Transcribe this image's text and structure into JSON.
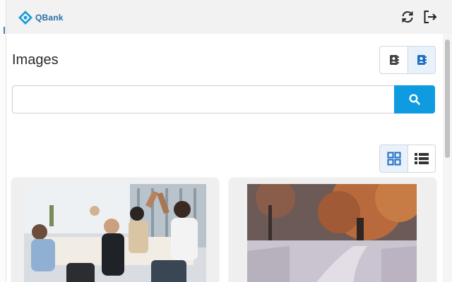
{
  "app": {
    "name": "QBank"
  },
  "page": {
    "title": "Images"
  },
  "search": {
    "value": "",
    "placeholder": ""
  },
  "icons": {
    "logo": "qbank-logo-icon",
    "refresh": "refresh-icon",
    "logout": "logout-icon",
    "mode_a": "address-book-icon",
    "mode_b": "contact-card-icon",
    "search": "search-icon",
    "grid": "grid-view-icon",
    "list": "list-view-icon"
  },
  "view": {
    "active": "grid"
  },
  "results": [
    {
      "kind": "photo",
      "subject": "office-team-high-five"
    },
    {
      "kind": "photo",
      "subject": "autumn-frosty-path"
    }
  ],
  "colors": {
    "accent": "#0e9be0",
    "brand": "#2a6fa6",
    "active_icon": "#1f6fc4"
  }
}
